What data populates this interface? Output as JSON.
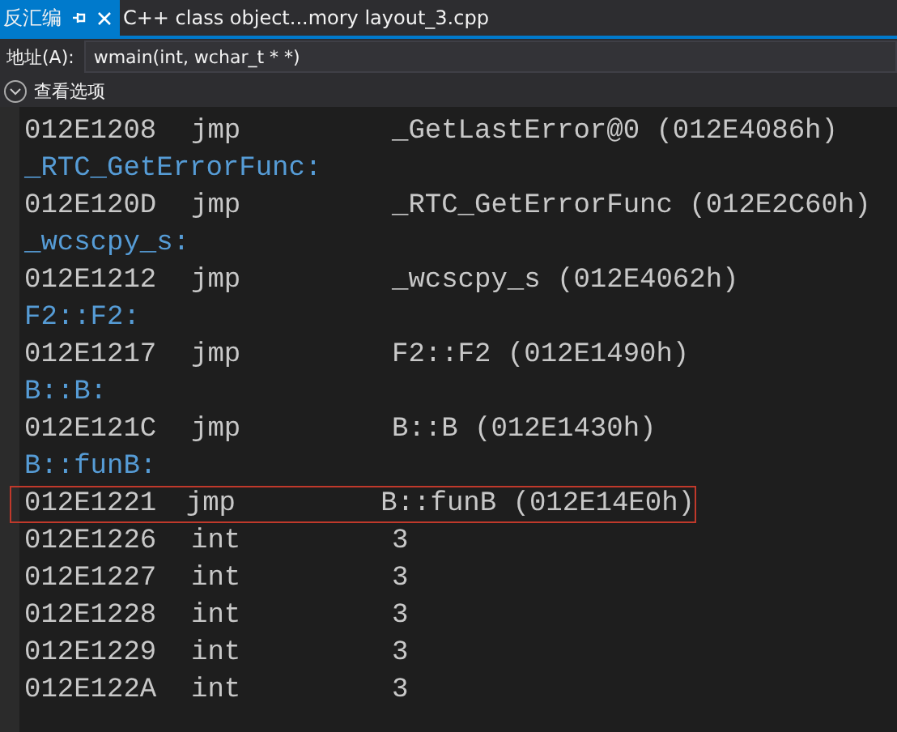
{
  "tabs": [
    {
      "label": "反汇编",
      "selected": true,
      "closable": true
    },
    {
      "label": "C++ class object...mory layout_3.cpp",
      "selected": false,
      "closable": false
    }
  ],
  "address_bar": {
    "label": "地址(A):",
    "value": "wmain(int, wchar_t * *)"
  },
  "options": {
    "label": "查看选项",
    "expanded": false
  },
  "lines": [
    {
      "kind": "instr",
      "address": "012E1208",
      "mnemonic": "jmp",
      "operand": "_GetLastError@0 (012E4086h)",
      "highlighted": false
    },
    {
      "kind": "label",
      "text": "_RTC_GetErrorFunc:"
    },
    {
      "kind": "instr",
      "address": "012E120D",
      "mnemonic": "jmp",
      "operand": "_RTC_GetErrorFunc (012E2C60h)",
      "highlighted": false
    },
    {
      "kind": "label",
      "text": "_wcscpy_s:"
    },
    {
      "kind": "instr",
      "address": "012E1212",
      "mnemonic": "jmp",
      "operand": "_wcscpy_s (012E4062h)",
      "highlighted": false
    },
    {
      "kind": "label",
      "text": "F2::F2:"
    },
    {
      "kind": "instr",
      "address": "012E1217",
      "mnemonic": "jmp",
      "operand": "F2::F2 (012E1490h)",
      "highlighted": false
    },
    {
      "kind": "label",
      "text": "B::B:"
    },
    {
      "kind": "instr",
      "address": "012E121C",
      "mnemonic": "jmp",
      "operand": "B::B (012E1430h)",
      "highlighted": false
    },
    {
      "kind": "label",
      "text": "B::funB:"
    },
    {
      "kind": "instr",
      "address": "012E1221",
      "mnemonic": "jmp",
      "operand": "B::funB (012E14E0h)",
      "highlighted": true
    },
    {
      "kind": "instr",
      "address": "012E1226",
      "mnemonic": "int",
      "operand": "3",
      "highlighted": false
    },
    {
      "kind": "instr",
      "address": "012E1227",
      "mnemonic": "int",
      "operand": "3",
      "highlighted": false
    },
    {
      "kind": "instr",
      "address": "012E1228",
      "mnemonic": "int",
      "operand": "3",
      "highlighted": false
    },
    {
      "kind": "instr",
      "address": "012E1229",
      "mnemonic": "int",
      "operand": "3",
      "highlighted": false
    },
    {
      "kind": "instr",
      "address": "012E122A",
      "mnemonic": "int",
      "operand": "3",
      "highlighted": false
    }
  ]
}
